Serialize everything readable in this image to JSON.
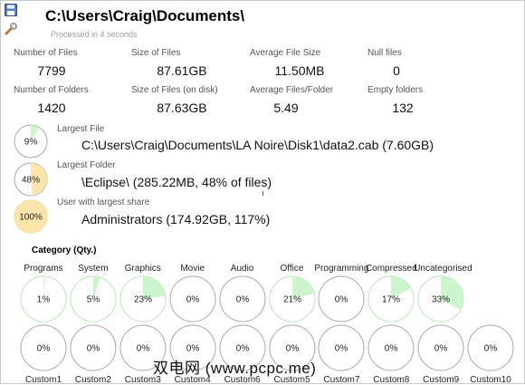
{
  "header": {
    "title": "C:\\Users\\Craig\\Documents\\",
    "processed": "Processed in 4 seconds"
  },
  "stats": [
    {
      "label": "Number of Files",
      "value": "7799"
    },
    {
      "label": "Size of Files",
      "value": "87.61GB"
    },
    {
      "label": "Average File Size",
      "value": "11.50MB"
    },
    {
      "label": "Null files",
      "value": "0"
    },
    {
      "label": "Number of Folders",
      "value": "1420"
    },
    {
      "label": "Size of Files (on disk)",
      "value": "87.63GB"
    },
    {
      "label": "Average Files/Folder",
      "value": "5.49"
    },
    {
      "label": "Empty folders",
      "value": "132"
    }
  ],
  "largest": [
    {
      "label": "Largest File",
      "percent": 9,
      "pct_text": "9%",
      "text": "C:\\Users\\Craig\\Documents\\LA Noire\\Disk1\\data2.cab (7.60GB)",
      "color": "#ccf5cc",
      "bg": "#ffffff"
    },
    {
      "label": "Largest Folder",
      "percent": 48,
      "pct_text": "48%",
      "text": "\\Eclipse\\ (285.22MB, 48% of files)",
      "color": "#fbe5a8",
      "bg": "#ffffff"
    },
    {
      "label": "User with largest share",
      "percent": 100,
      "pct_text": "100%",
      "text": "Administrators (174.92GB, 117%)",
      "color": "#fbe5a8",
      "bg": "#fbe5a8"
    }
  ],
  "category": {
    "title": "Category (Qty.)",
    "row1": [
      {
        "name": "Programs",
        "percent": 1,
        "pct_text": "1%"
      },
      {
        "name": "System",
        "percent": 5,
        "pct_text": "5%"
      },
      {
        "name": "Graphics",
        "percent": 23,
        "pct_text": "23%"
      },
      {
        "name": "Movie",
        "percent": 0,
        "pct_text": "0%"
      },
      {
        "name": "Audio",
        "percent": 0,
        "pct_text": "0%"
      },
      {
        "name": "Office",
        "percent": 21,
        "pct_text": "21%"
      },
      {
        "name": "Programming",
        "percent": 0,
        "pct_text": "0%"
      },
      {
        "name": "Compressed",
        "percent": 17,
        "pct_text": "17%"
      },
      {
        "name": "Uncategorised",
        "percent": 33,
        "pct_text": "33%"
      }
    ],
    "row2": [
      {
        "name": "Custom1",
        "percent": 0,
        "pct_text": "0%"
      },
      {
        "name": "Custom2",
        "percent": 0,
        "pct_text": "0%"
      },
      {
        "name": "Custom3",
        "percent": 0,
        "pct_text": "0%"
      },
      {
        "name": "Custom4",
        "percent": 0,
        "pct_text": "0%"
      },
      {
        "name": "Custom6",
        "percent": 0,
        "pct_text": "0%"
      },
      {
        "name": "Custom5",
        "percent": 0,
        "pct_text": "0%"
      },
      {
        "name": "Custom7",
        "percent": 0,
        "pct_text": "0%"
      },
      {
        "name": "Custom8",
        "percent": 0,
        "pct_text": "0%"
      },
      {
        "name": "Custom9",
        "percent": 0,
        "pct_text": "0%"
      },
      {
        "name": "Custom10",
        "percent": 0,
        "pct_text": "0%"
      }
    ],
    "fill_color": "#ccf5cc",
    "ring_color": "#a8a8a8"
  },
  "watermark": "双电网 (www.pcpc.me)"
}
